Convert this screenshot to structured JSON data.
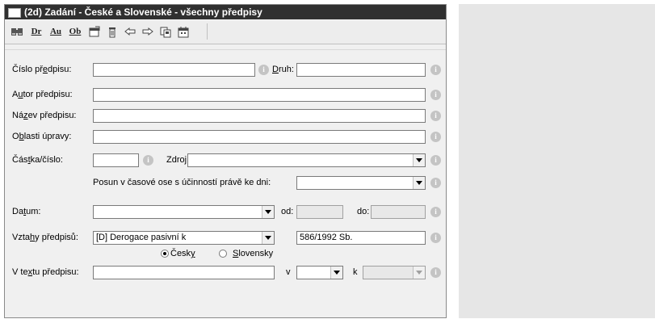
{
  "window": {
    "title": "(2d) Zadání - České a Slovenské - všechny předpisy"
  },
  "toolbar": {
    "buttons": [
      {
        "icon": "find-icon"
      },
      {
        "label": "Dr"
      },
      {
        "label": "Au"
      },
      {
        "label": "Ob"
      },
      {
        "icon": "properties-icon"
      },
      {
        "icon": "trash-icon"
      },
      {
        "icon": "back-icon"
      },
      {
        "icon": "forward-icon"
      },
      {
        "icon": "copy-icon"
      },
      {
        "icon": "calendar-icon"
      }
    ]
  },
  "form": {
    "cislo": {
      "label_pre": "Číslo př",
      "label_u": "e",
      "label_post": "dpisu:",
      "value": ""
    },
    "druh": {
      "label_u": "D",
      "label_post": "ruh:",
      "value": ""
    },
    "autor": {
      "label_pre": "A",
      "label_u": "u",
      "label_post": "tor předpisu:",
      "value": ""
    },
    "nazev": {
      "label_pre": "Ná",
      "label_u": "z",
      "label_post": "ev předpisu:",
      "value": ""
    },
    "oblasti": {
      "label_pre": "O",
      "label_u": "b",
      "label_post": "lasti úpravy:",
      "value": ""
    },
    "castka": {
      "label_pre": "Čás",
      "label_u": "t",
      "label_post": "ka/číslo:",
      "value": ""
    },
    "zdroj": {
      "label": "Zdroj:",
      "value": ""
    },
    "posun": {
      "label": "Posun v časové ose s účinností právě ke dni:",
      "value": ""
    },
    "datum": {
      "label_pre": "Da",
      "label_u": "t",
      "label_post": "um:",
      "value": "",
      "od_label": "od:",
      "do_label": "do:",
      "od_value": "",
      "do_value": ""
    },
    "vztahy": {
      "label_pre": "Vzta",
      "label_u": "h",
      "label_post": "y předpisů:",
      "value": "[D]  Derogace pasivní k",
      "ref_value": "586/1992 Sb."
    },
    "lang": {
      "cesky_pre": "Česk",
      "cesky_u": "y",
      "slovensky_u": "S",
      "slovensky_post": "lovensky",
      "selected": "cesky"
    },
    "vtextu": {
      "label_pre": "V te",
      "label_u": "x",
      "label_post": "tu předpisu:",
      "value": "",
      "v_label": "v",
      "k_label": "k",
      "v_value": "",
      "k_value": ""
    }
  },
  "info_glyph": "i"
}
